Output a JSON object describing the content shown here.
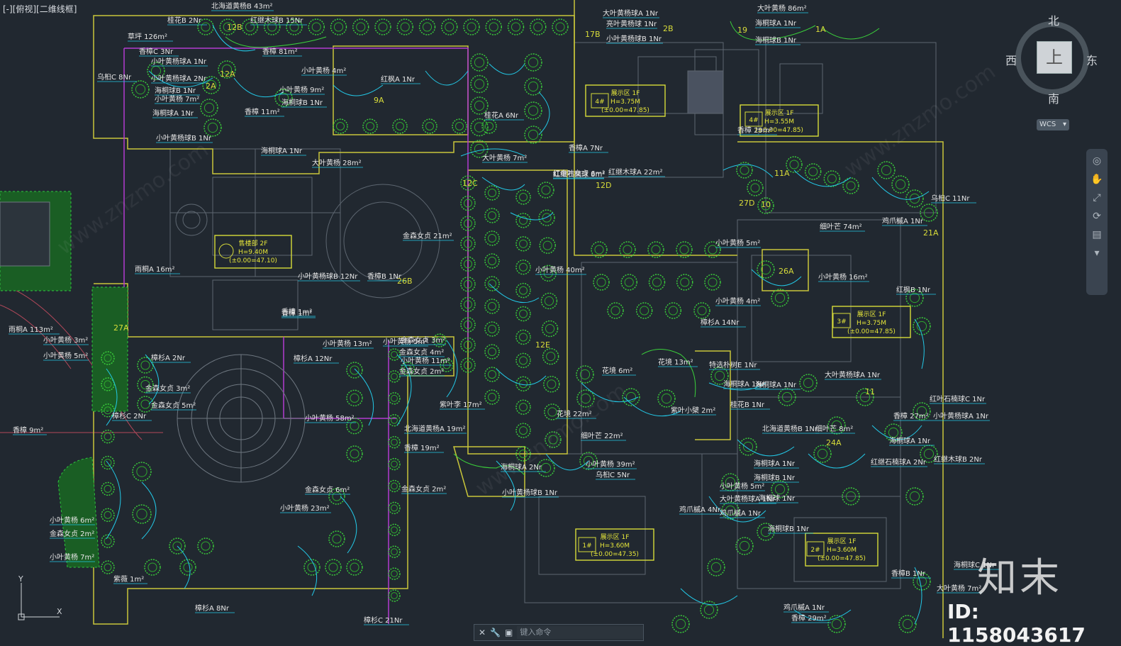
{
  "viewport": {
    "label": "[-][俯视][二维线框]"
  },
  "viewcube": {
    "north": "北",
    "south": "南",
    "west": "西",
    "east": "东",
    "face": "上",
    "wcs": "WCS"
  },
  "command_line": {
    "placeholder": "键入命令"
  },
  "watermark": {
    "brand": "知末",
    "id": "ID: 1158043617"
  },
  "colors": {
    "background": "#212830",
    "plant_green": "#3bd23b",
    "cyan_leader": "#23c8e6",
    "boundary_yellow": "#c9c63a",
    "magenta": "#b23ad0",
    "hatch_green": "#1f8a2a"
  },
  "zones": [
    {
      "title": "售楼部 2F",
      "h": "H=9.40M",
      "elev": "(±0.00=47.10)"
    },
    {
      "title": "展示区 1F",
      "h": "H=3.75M",
      "elev": "(±0.00=47.85)"
    },
    {
      "title": "展示区 1F",
      "h": "H=3.55M",
      "elev": "(±0.00=47.85)"
    },
    {
      "title": "展示区 1F",
      "h": "H=3.75M",
      "elev": "(±0.00=47.85)"
    },
    {
      "title": "展示区 1F",
      "h": "H=3.60M",
      "elev": "(±0.00=47.35)"
    },
    {
      "title": "展示区 1F",
      "h": "H=3.60M",
      "elev": "(±0.00=47.85)"
    }
  ],
  "zone_ids": [
    "4#",
    "4#",
    "3#",
    "1#",
    "2#"
  ],
  "labels": [
    "北海道黄杨B 43m²",
    "桂花B 2Nr",
    "红继木球B 15Nr",
    "草坪 126m²",
    "香樟C 3Nr",
    "小叶黄杨球A 1Nr",
    "乌桕C 8Nr",
    "香樟 81m²",
    "小叶黄杨球A 2Nr",
    "海桐球B 1Nr",
    "小叶黄杨 7m²",
    "海桐球A 1Nr",
    "小叶黄杨 4m²",
    "香樟 11m²",
    "红枫A 1Nr",
    "小叶黄杨 9m²",
    "海桐球B 1Nr",
    "小叶黄杨球B 1Nr",
    "大叶黄杨 28m²",
    "海桐球A 1Nr",
    "大叶黄杨 7m²",
    "桂花A 6Nr",
    "香樟A 7Nr",
    "大叶黄杨球A 1Nr",
    "亮叶黄杨球 1Nr",
    "小叶黄杨球B 1Nr",
    "红金叶女贞 6m²",
    "海桐球B 1Nr",
    "大叶黄杨 86m²",
    "海桐球A 1Nr",
    "香樟 29m²",
    "金森女贞 21m²",
    "香樟B 1Nr",
    "小叶黄杨球B 12Nr",
    "小叶黄杨 40m²",
    "红继石楠球 8m²",
    "红继木球A 22m²",
    "金森女贞 4m²",
    "金森女贞 2m²",
    "金森女贞 3m²",
    "小叶黄杨 5m²",
    "小叶黄杨 11m²",
    "小叶黄杨 13m²",
    "香樟 1m²",
    "香樟 9m²",
    "雨桐A 113m²",
    "小叶黄杨 3m²",
    "小叶黄杨 5m²",
    "樟杉C 2Nr",
    "樟杉A 12Nr",
    "樟杉A 2Nr",
    "金森女贞 3m²",
    "金森女贞 5m²",
    "小叶黄杨 58m²",
    "北海道黄杨A 19m²",
    "香樟 19m²",
    "金森女贞 6m²",
    "小叶黄杨 23m²",
    "金森女贞 2m²",
    "小叶黄杨 6m²",
    "金森女贞 2m²",
    "小叶黄杨 7m²",
    "海桐球A 2Nr",
    "小叶黄杨 39m²",
    "乌桕C 5Nr",
    "小叶黄杨球B 1Nr",
    "香樟 1m²",
    "紫薇 1m²",
    "樟杉A 8Nr",
    "樟杉C 21Nr",
    "花境 6m²",
    "花境 13m²",
    "紫叶李 17m²",
    "花境 22m²",
    "细叶芒 22m²",
    "紫叶小檗 2m²",
    "海桐球A 1Nr",
    "鸡爪槭A 4Nr",
    "大叶黄杨球A 1Nr",
    "雨桐A 16m²",
    "樟杉A 14Nr",
    "红枫B 1Nr",
    "小叶黄杨 16m²",
    "小叶黄杨 4m²",
    "小叶黄杨 5m²",
    "细叶芒 74m²",
    "鸡爪槭A 1Nr",
    "乌桕C 11Nr",
    "桂花B 1Nr",
    "红叶石楠球C 1Nr",
    "小叶黄杨球A 1Nr",
    "海桐球A 1Nr",
    "香樟 29m²",
    "红继木球B 2Nr",
    "海桐球C 1Nr",
    "香樟B 1Nr",
    "大叶黄杨 7m²",
    "红继石楠球A 2Nr",
    "北海道黄杨B 1Nr",
    "海桐球A 1Nr",
    "海桐球B 1Nr",
    "小叶黄杨 5m²",
    "大叶黄杨球A 1Nr",
    "海桐球 1Nr",
    "鸡爪槭A 1Nr",
    "海桐球B 1Nr",
    "特选朴树E 1Nr",
    "海桐球A 1Nr",
    "鸡爪槭A 1Nr",
    "香樟 27m²",
    "细叶芒 8m²"
  ],
  "plant_tags": [
    "12B",
    "12A",
    "12C",
    "12E",
    "12D",
    "26B",
    "27A",
    "9A",
    "11",
    "10",
    "11A",
    "19",
    "1A",
    "2A",
    "2B",
    "17B",
    "24A",
    "21A",
    "27D",
    "26A"
  ]
}
